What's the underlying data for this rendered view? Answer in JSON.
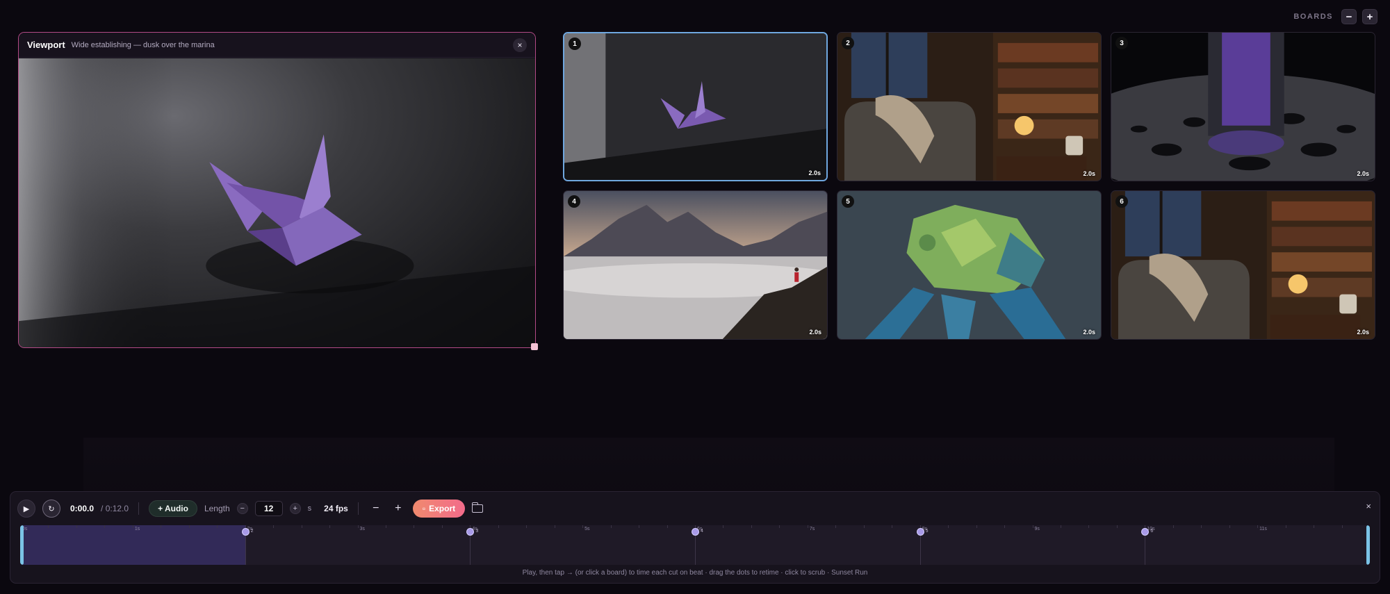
{
  "header": {
    "boards_label": "BOARDS",
    "zoom_out": "−",
    "zoom_in": "+"
  },
  "viewport": {
    "title": "Viewport",
    "subtitle": "Wide establishing — dusk over the marina",
    "close": "×"
  },
  "boards": [
    {
      "number": "1",
      "duration": "2.0s",
      "subject": "origami crane on slate",
      "selected": true
    },
    {
      "number": "2",
      "duration": "2.0s",
      "subject": "armchair by bookshelf with lantern"
    },
    {
      "number": "3",
      "duration": "2.0s",
      "subject": "glass on wet surface"
    },
    {
      "number": "4",
      "duration": "2.0s",
      "subject": "hiker above sea of clouds"
    },
    {
      "number": "5",
      "duration": "2.0s",
      "subject": "origami frog"
    },
    {
      "number": "6",
      "duration": "2.0s",
      "subject": "armchair by bookshelf with lantern"
    }
  ],
  "timeline": {
    "play_icon": "▶",
    "loop_icon": "↻",
    "current_time": "0:00.0",
    "total_time": "/ 0:12.0",
    "audio_label": "+ Audio",
    "length_label": "Length",
    "length_minus": "−",
    "length_value": "12",
    "length_plus": "+",
    "length_unit": "s",
    "fps": "24 fps",
    "zoom_out": "−",
    "zoom_in": "+",
    "export_label": "Export",
    "close": "×",
    "playhead_fraction": 0.0,
    "played_fraction": 0.1667,
    "ticks": [
      "0s",
      "1s",
      "2s",
      "3s",
      "4s",
      "5s",
      "6s",
      "7s",
      "8s",
      "9s",
      "10s",
      "11s"
    ],
    "cuts": [
      {
        "time": 2,
        "label": "2"
      },
      {
        "time": 4,
        "label": "3"
      },
      {
        "time": 6,
        "label": "4"
      },
      {
        "time": 8,
        "label": "5"
      },
      {
        "time": 10,
        "label": "6"
      }
    ],
    "length_seconds": 12,
    "hint": "Play, then tap → (or click a board) to time each cut on beat · drag the dots to retime · click to scrub · Sunset Run"
  }
}
